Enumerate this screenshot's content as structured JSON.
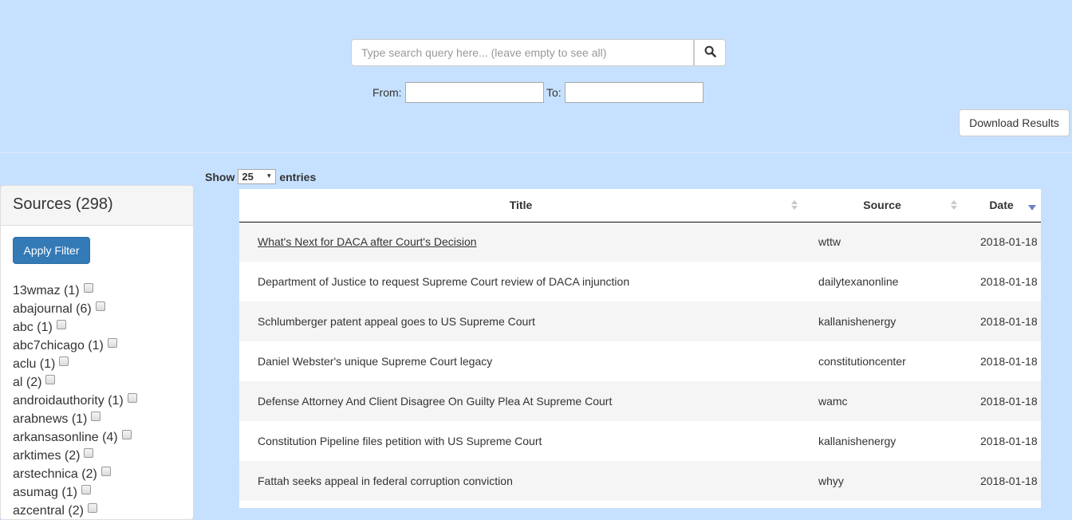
{
  "search": {
    "placeholder": "Type search query here... (leave empty to see all)",
    "value": ""
  },
  "dates": {
    "from_label": "From:",
    "to_label": "To:",
    "from_value": "",
    "to_value": ""
  },
  "download_label": "Download Results",
  "sidebar": {
    "title": "Sources (298)",
    "apply_label": "Apply Filter",
    "sources": [
      "13wmaz (1)",
      "abajournal (6)",
      "abc (1)",
      "abc7chicago (1)",
      "aclu (1)",
      "al (2)",
      "androidauthority (1)",
      "arabnews (1)",
      "arkansasonline (4)",
      "arktimes (2)",
      "arstechnica (2)",
      "asumag (1)",
      "azcentral (2)"
    ]
  },
  "length": {
    "show_label": "Show",
    "value": "25",
    "entries_label": "entries"
  },
  "table": {
    "headers": [
      "Title",
      "Source",
      "Date"
    ],
    "rows": [
      {
        "title": "What's Next for DACA after Court's Decision",
        "source": "wttw",
        "date": "2018-01-18"
      },
      {
        "title": "Department of Justice to request Supreme Court review of DACA injunction",
        "source": "dailytexanonline",
        "date": "2018-01-18"
      },
      {
        "title": "Schlumberger patent appeal goes to US Supreme Court",
        "source": "kallanishenergy",
        "date": "2018-01-18"
      },
      {
        "title": "Daniel Webster's unique Supreme Court legacy",
        "source": "constitutioncenter",
        "date": "2018-01-18"
      },
      {
        "title": "Defense Attorney And Client Disagree On Guilty Plea At Supreme Court",
        "source": "wamc",
        "date": "2018-01-18"
      },
      {
        "title": "Constitution Pipeline files petition with US Supreme Court",
        "source": "kallanishenergy",
        "date": "2018-01-18"
      },
      {
        "title": "Fattah seeks appeal in federal corruption conviction",
        "source": "whyy",
        "date": "2018-01-18"
      },
      {
        "title": "",
        "source": "",
        "date": ""
      }
    ]
  }
}
